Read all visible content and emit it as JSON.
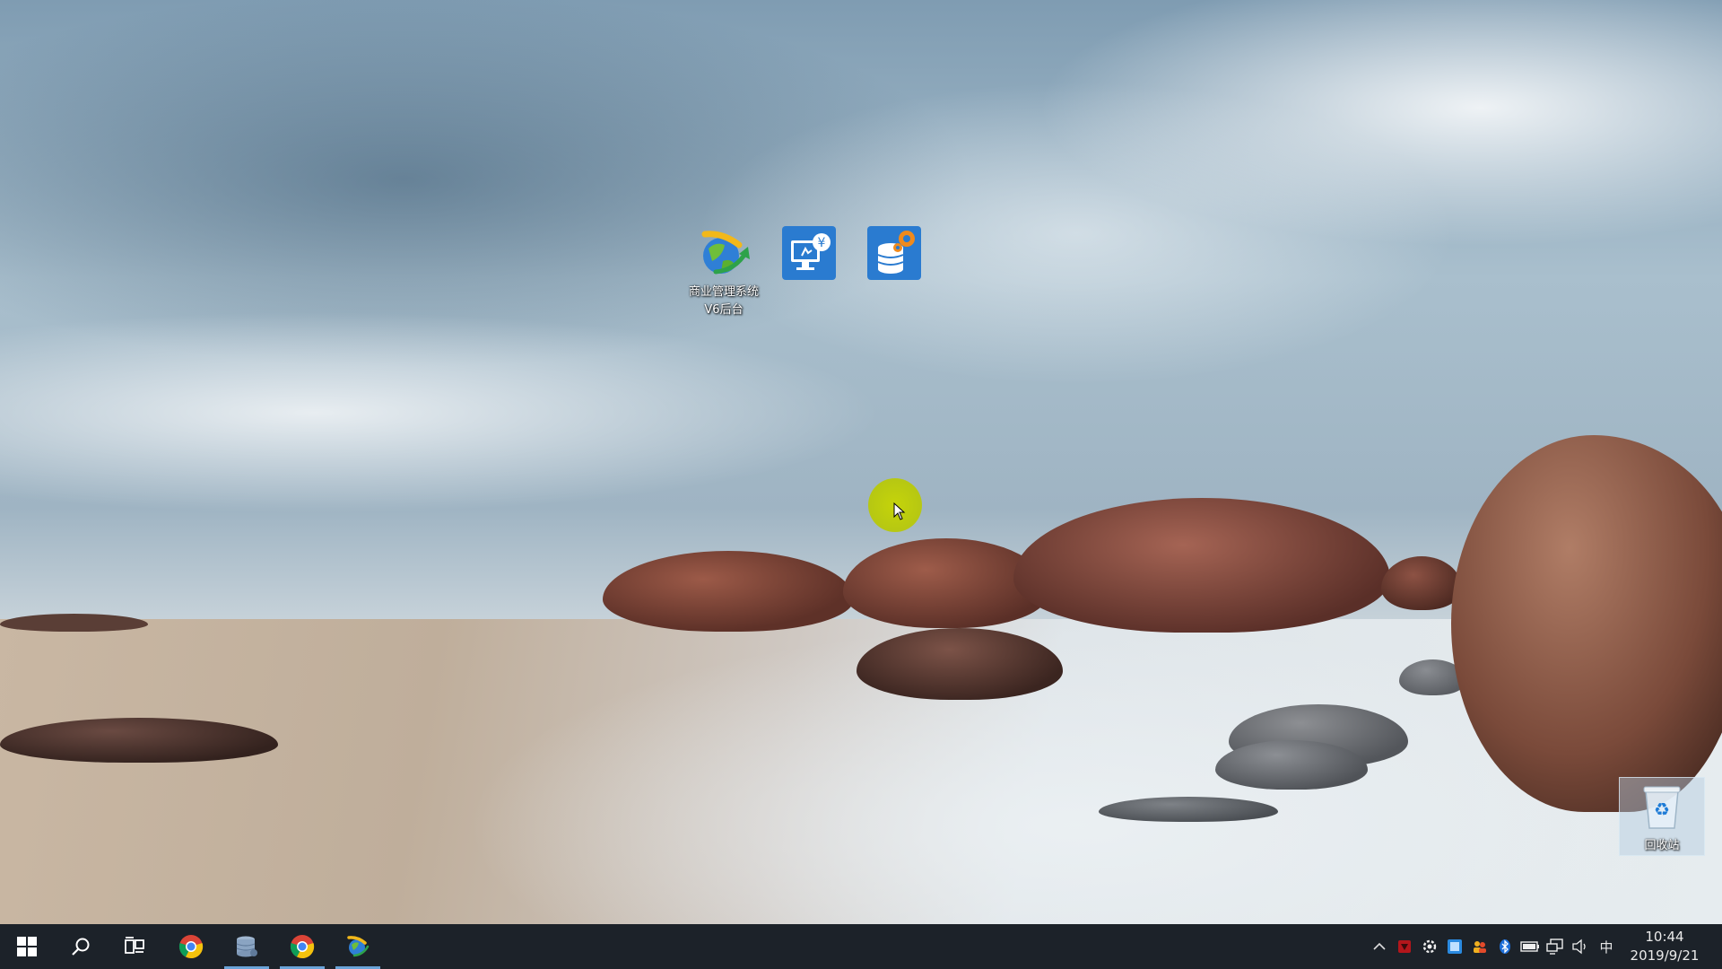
{
  "desktop": {
    "icons": [
      {
        "name": "商业管理系统V6后台",
        "line1": "商业管理系统",
        "line2": "V6后台"
      },
      {
        "name": "",
        "line1": "",
        "line2": ""
      },
      {
        "name": "",
        "line1": "",
        "line2": ""
      }
    ],
    "recycle_bin": {
      "label": "回收站",
      "icon": "recycle-bin-icon"
    }
  },
  "taskbar": {
    "start_icon": "windows-start-icon",
    "search_icon": "search-icon",
    "task_view_icon": "task-view-icon",
    "pinned": [
      {
        "app": "chrome",
        "icon": "chrome-icon",
        "active": false
      },
      {
        "app": "database",
        "icon": "database-icon",
        "active": true
      },
      {
        "app": "chrome",
        "icon": "chrome-icon",
        "active": true
      },
      {
        "app": "business-system",
        "icon": "globe-arrow-icon",
        "active": true
      }
    ],
    "tray": {
      "ime": "中",
      "time": "10:44",
      "date": "2019/9/21"
    }
  },
  "colors": {
    "taskbar_bg": "#1c2229",
    "active_indicator": "#6aa3d8",
    "cursor_highlight": "#c5d40a",
    "icon_blue": "#2a7bd0"
  }
}
